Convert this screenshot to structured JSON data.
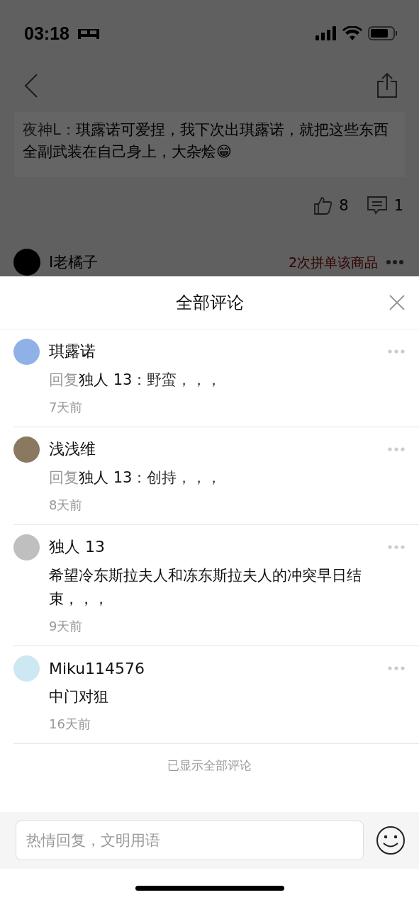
{
  "status_bar": {
    "time": "03:18"
  },
  "post": {
    "quote_author": "夜神L：",
    "quote_text": "琪露诺可爱捏，我下次出琪露诺，就把这些东西全副武装在自己身上，大杂烩😁",
    "likes": "8",
    "replies": "1"
  },
  "next_post": {
    "user": "I老橘子",
    "purchase_note": "2次拼单该商品"
  },
  "sheet": {
    "title": "全部评论"
  },
  "comments": [
    {
      "user": "琪露诺",
      "kind": "reply",
      "prefix": "回复",
      "target": "独人 13",
      "text": "：野蛮，，，",
      "time": "7天前"
    },
    {
      "user": "浅浅维",
      "kind": "reply",
      "prefix": "回复",
      "target": "独人 13",
      "text": "：创持，，，",
      "time": "8天前"
    },
    {
      "user": "独人 13",
      "kind": "plain",
      "text": "希望冷东斯拉夫人和冻东斯拉夫人的冲突早日结束，，，",
      "time": "9天前"
    },
    {
      "user": "Miku114576",
      "kind": "plain",
      "text": "中门对狙",
      "time": "16天前"
    }
  ],
  "footer_note": "已显示全部评论",
  "input": {
    "placeholder": "热情回复，文明用语"
  }
}
